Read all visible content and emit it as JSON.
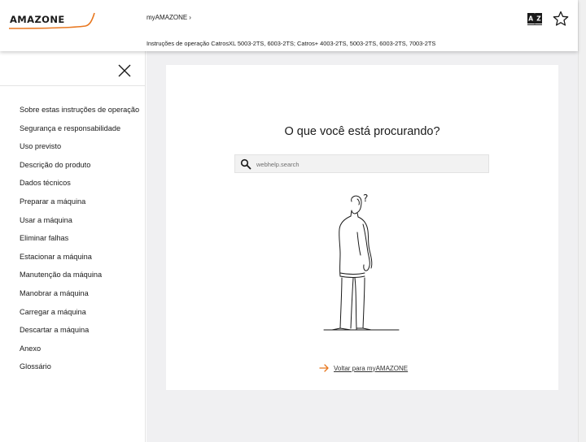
{
  "header": {
    "logo_text": "AMAZONE",
    "breadcrumb": "myAMAZONE",
    "breadcrumb_sep": "›",
    "document_title": "Instruções de operação CatrosXL 5003-2TS, 6003-2TS; Catros+ 4003-2TS, 5003-2TS, 6003-2TS, 7003-2TS",
    "dictionary_icon": "book-az-icon",
    "favorite_icon": "star-icon"
  },
  "sidebar": {
    "close_icon": "close-icon",
    "items": [
      {
        "label": "Sobre estas instruções de operação"
      },
      {
        "label": "Segurança e responsabilidade"
      },
      {
        "label": "Uso previsto"
      },
      {
        "label": "Descrição do produto"
      },
      {
        "label": "Dados técnicos"
      },
      {
        "label": "Preparar a máquina"
      },
      {
        "label": "Usar a máquina"
      },
      {
        "label": "Eliminar falhas"
      },
      {
        "label": "Estacionar a máquina"
      },
      {
        "label": "Manutenção da máquina"
      },
      {
        "label": "Manobrar a máquina"
      },
      {
        "label": "Carregar a máquina"
      },
      {
        "label": "Descartar a máquina"
      },
      {
        "label": "Anexo"
      },
      {
        "label": "Glossário"
      }
    ]
  },
  "main": {
    "heading": "O que você está procurando?",
    "search": {
      "placeholder": "webhelp.search",
      "value": "",
      "icon": "search-icon"
    },
    "illustration_question": "?",
    "back_link": {
      "label": "Voltar para myAMAZONE",
      "icon": "arrow-right-icon"
    }
  },
  "colors": {
    "accent_orange": "#e8771f",
    "main_bg": "#f0f0f2",
    "text": "#1a1a1a"
  }
}
